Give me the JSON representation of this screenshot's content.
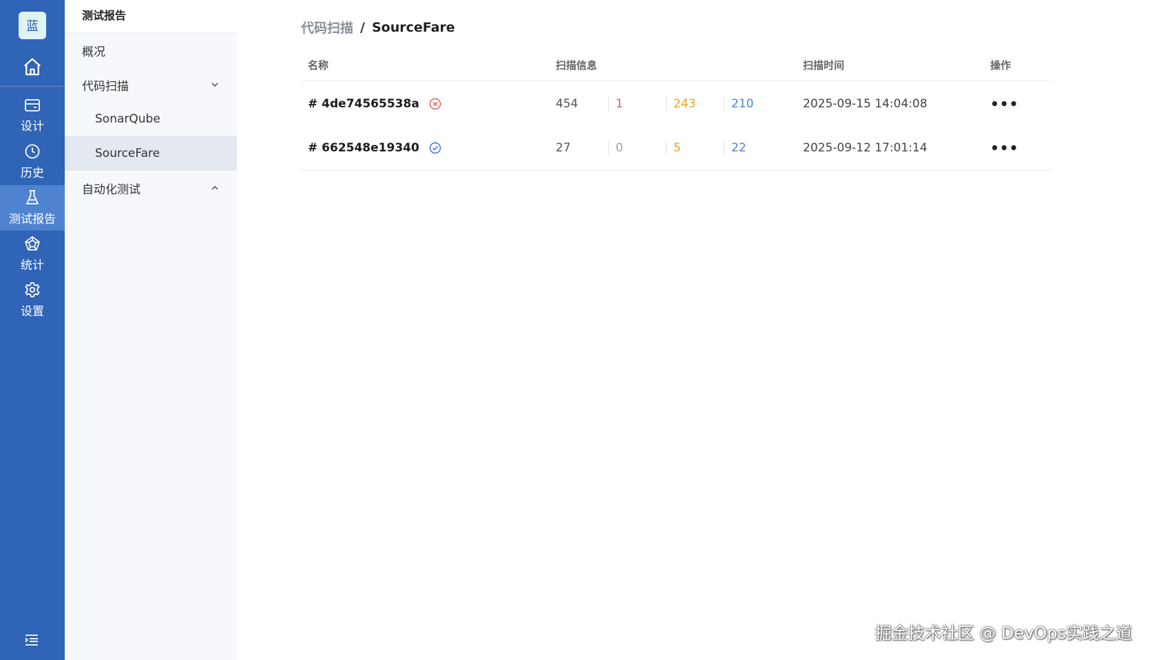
{
  "rail": {
    "logo": "蓝",
    "items": [
      {
        "label": "设计",
        "icon": "card-icon"
      },
      {
        "label": "历史",
        "icon": "clock-icon"
      },
      {
        "label": "测试报告",
        "icon": "flask-icon",
        "active": true
      },
      {
        "label": "统计",
        "icon": "pentagon-icon"
      },
      {
        "label": "设置",
        "icon": "gear-icon"
      }
    ],
    "accent": "#2f64b7"
  },
  "sub": {
    "title": "测试报告",
    "items": [
      {
        "label": "概况"
      },
      {
        "label": "代码扫描",
        "chevron": "down"
      },
      {
        "label": "SonarQube",
        "child": true
      },
      {
        "label": "SourceFare",
        "child": true,
        "active": true
      },
      {
        "label": "自动化测试",
        "chevron": "up"
      }
    ]
  },
  "breadcrumb": {
    "parent": "代码扫描",
    "separator": "/",
    "current": "SourceFare"
  },
  "table": {
    "headers": [
      "名称",
      "扫描信息",
      "扫描时间",
      "操作"
    ],
    "rows": [
      {
        "name": "# 4de74565538a",
        "status": "failed",
        "total": "454",
        "v1": "1",
        "v2": "243",
        "v3": "210",
        "time": "2025-09-15 14:04:08",
        "op": "•••"
      },
      {
        "name": "# 662548e19340",
        "status": "success",
        "total": "27",
        "v1": "0",
        "v2": "5",
        "v3": "22",
        "time": "2025-09-12 17:01:14",
        "op": "•••"
      }
    ]
  },
  "watermark": "掘金技术社区 @ DevOps实践之道"
}
